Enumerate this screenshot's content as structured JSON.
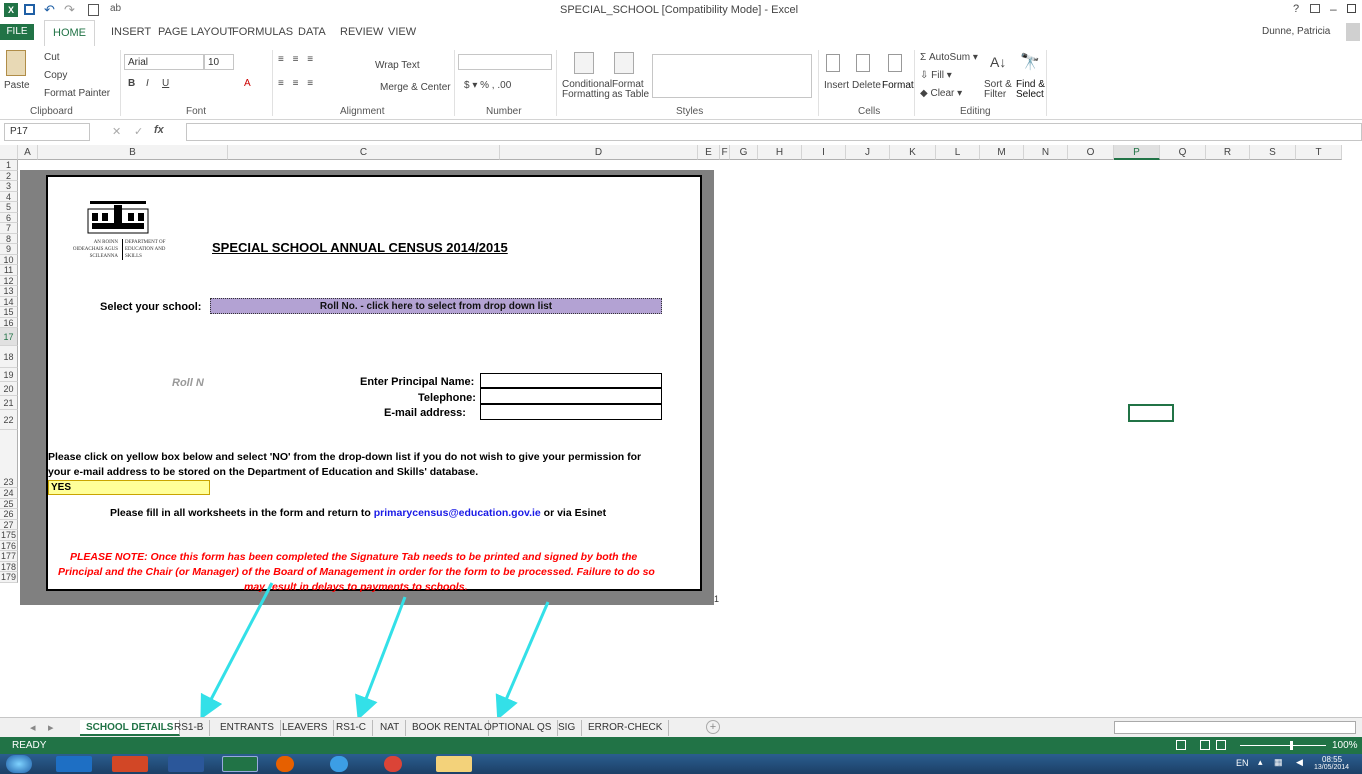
{
  "window": {
    "title": "SPECIAL_SCHOOL  [Compatibility Mode] - Excel",
    "user": "Dunne, Patricia"
  },
  "ribbon_tabs": [
    "FILE",
    "HOME",
    "INSERT",
    "PAGE LAYOUT",
    "FORMULAS",
    "DATA",
    "REVIEW",
    "VIEW"
  ],
  "ribbon": {
    "cut": "Cut",
    "copy": "Copy",
    "paste": "Paste",
    "format_painter": "Format Painter",
    "font_name": "Arial",
    "font_size": "10",
    "wrap_text": "Wrap Text",
    "merge_center": "Merge & Center",
    "conditional_formatting": "Conditional Formatting",
    "format_as_table": "Format as Table",
    "insert": "Insert",
    "delete": "Delete",
    "format": "Format",
    "autosum": "AutoSum",
    "fill": "Fill",
    "clear": "Clear",
    "sort_filter": "Sort & Filter",
    "find_select": "Find & Select",
    "groups": {
      "clipboard": "Clipboard",
      "font": "Font",
      "alignment": "Alignment",
      "number": "Number",
      "styles": "Styles",
      "cells": "Cells",
      "editing": "Editing"
    }
  },
  "formula_bar": {
    "name_box": "P17",
    "fx": "fx",
    "value": ""
  },
  "columns": [
    "A",
    "B",
    "C",
    "D",
    "E",
    "F",
    "G",
    "H",
    "I",
    "J",
    "K",
    "L",
    "M",
    "N",
    "O",
    "P",
    "Q",
    "R",
    "S",
    "T"
  ],
  "rows": [
    "1",
    "2",
    "3",
    "4",
    "5",
    "6",
    "7",
    "8",
    "9",
    "10",
    "11",
    "12",
    "13",
    "14",
    "15",
    "16",
    "17",
    "18",
    "19",
    "20",
    "21",
    "22",
    "23",
    "24",
    "25",
    "26",
    "27",
    "175",
    "176",
    "177",
    "178",
    "179"
  ],
  "form": {
    "logo_text_left": "AN ROINN OIDEACHAIS AGUS SCILEANNA",
    "logo_text_right": "DEPARTMENT OF EDUCATION AND SKILLS",
    "title": "SPECIAL SCHOOL ANNUAL CENSUS 2014/2015",
    "select_school_label": "Select your school:",
    "roll_dropdown": "Roll No. - click here to select from drop down list",
    "roll_n": "Roll N",
    "principal_label": "Enter Principal Name:",
    "telephone_label": "Telephone:",
    "email_label": "E-mail address:",
    "permission_line1": "Please click on yellow box below and select 'NO' from the drop-down list if you do not wish to give your permission for",
    "permission_line2": "your e-mail address to be stored on the Department of Education and Skills' database.",
    "permission_value": "YES",
    "fill_prefix": "Please fill in all worksheets in the form and return to ",
    "fill_email": "primarycensus@education.gov.ie",
    "fill_suffix": " or via Esinet",
    "note_line1": "PLEASE NOTE:  Once this form has been completed the Signature Tab needs to be printed and signed by both the",
    "note_line2": "Principal and the Chair (or Manager) of the Board of Management in order for the form to be processed.  Failure to do so",
    "note_line3": "may result in delays to payments to schools.",
    "page_number": "1"
  },
  "sheet_tabs": [
    "SCHOOL DETAILS",
    "RS1-B",
    "ENTRANTS",
    "LEAVERS",
    "RS1-C",
    "NAT",
    "BOOK RENTAL",
    "OPTIONAL QS",
    "SIG",
    "ERROR-CHECK"
  ],
  "status": {
    "mode": "READY",
    "zoom": "100%"
  },
  "taskbar": {
    "lang": "EN",
    "time": "08:55",
    "date": "13/05/2014"
  },
  "colors": {
    "excel_green": "#217346",
    "arrow": "#33e0e8",
    "dropdown": "#b3a2d3",
    "yes_cell": "#ffff99",
    "note_red": "#ff0000"
  }
}
